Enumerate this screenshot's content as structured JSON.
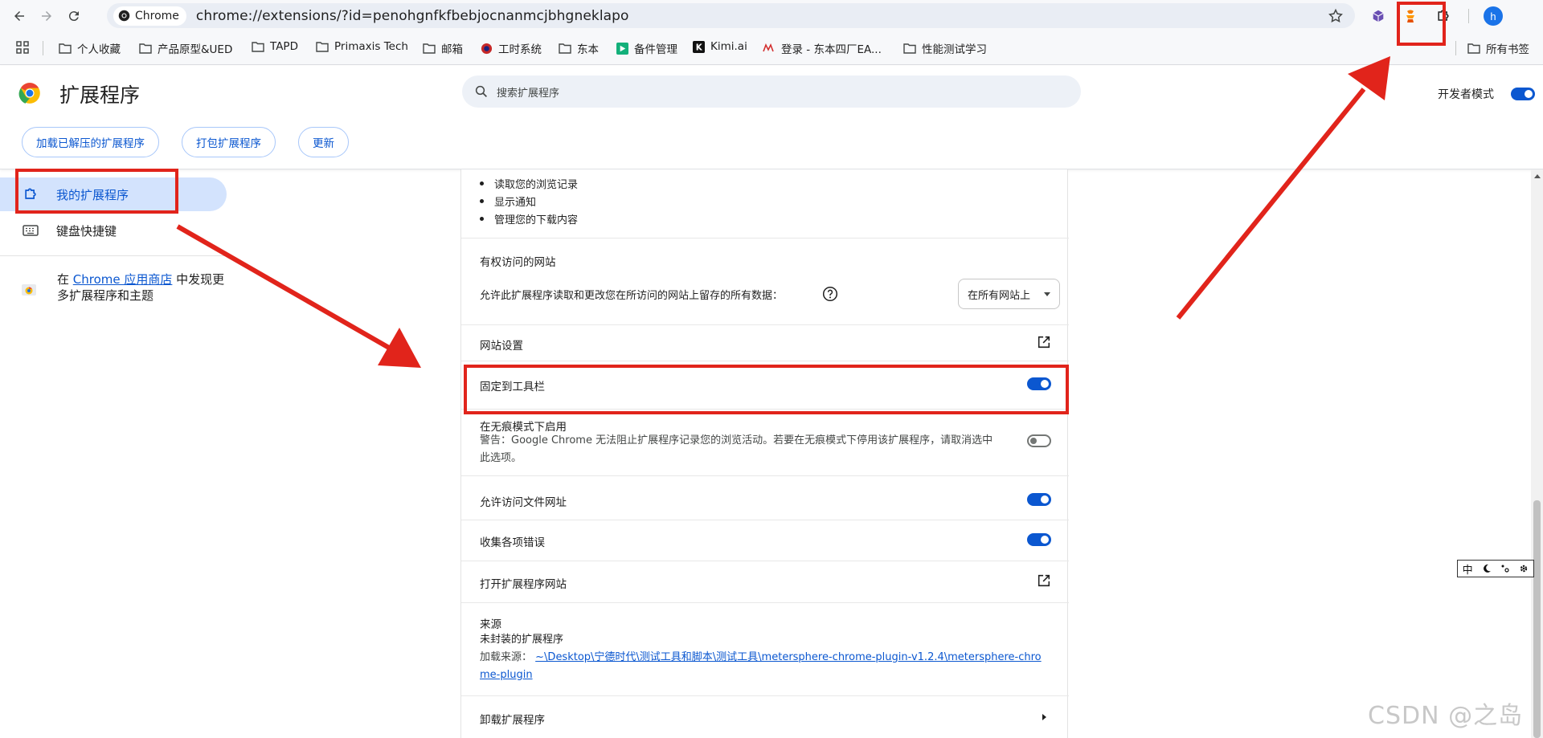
{
  "browser": {
    "chip_label": "Chrome",
    "url": "chrome://extensions/?id=penohgnfkfbebjocnanmcjbhgneklapo",
    "avatar_letter": "h"
  },
  "bookmarks": {
    "items": [
      "个人收藏",
      "产品原型&UED",
      "TAPD",
      "Primaxis Tech",
      "邮箱",
      "工时系统",
      "东本",
      "备件管理",
      "Kimi.ai",
      "登录 - 东本四厂EA...",
      "性能测试学习"
    ],
    "all_bookmarks": "所有书签"
  },
  "header": {
    "title": "扩展程序",
    "search_placeholder": "搜索扩展程序",
    "developer_mode_label": "开发者模式",
    "buttons": [
      "加载已解压的扩展程序",
      "打包扩展程序",
      "更新"
    ]
  },
  "sidebar": {
    "items": [
      "我的扩展程序",
      "键盘快捷键"
    ],
    "webstore_prefix": "在 ",
    "webstore_link": "Chrome 应用商店",
    "webstore_suffix": " 中发现更多扩展程序和主题"
  },
  "detail": {
    "permissions": [
      "读取您的浏览记录",
      "显示通知",
      "管理您的下载内容"
    ],
    "site_access_title": "有权访问的网站",
    "site_access_desc": "允许此扩展程序读取和更改您在所访问的网站上留存的所有数据：",
    "site_access_value": "在所有网站上",
    "site_settings": "网站设置",
    "pin_toolbar": "固定到工具栏",
    "incognito_title": "在无痕模式下启用",
    "incognito_warning": "警告：Google Chrome 无法阻止扩展程序记录您的浏览活动。若要在无痕模式下停用该扩展程序，请取消选中此选项。",
    "file_urls": "允许访问文件网址",
    "collect_errors": "收集各项错误",
    "open_website": "打开扩展程序网站",
    "source_title": "来源",
    "source_type": "未封装的扩展程序",
    "source_path_label": "加载来源：",
    "source_path": "~\\Desktop\\宁德时代\\测试工具和脚本\\测试工具\\metersphere-chrome-plugin-v1.2.4\\metersphere-chrome-plugin",
    "uninstall": "卸载扩展程序"
  },
  "ime": {
    "mode": "中"
  },
  "watermark": "CSDN @之岛",
  "colors": {
    "accent": "#0b57d0",
    "annotation_red": "#e1241b"
  }
}
